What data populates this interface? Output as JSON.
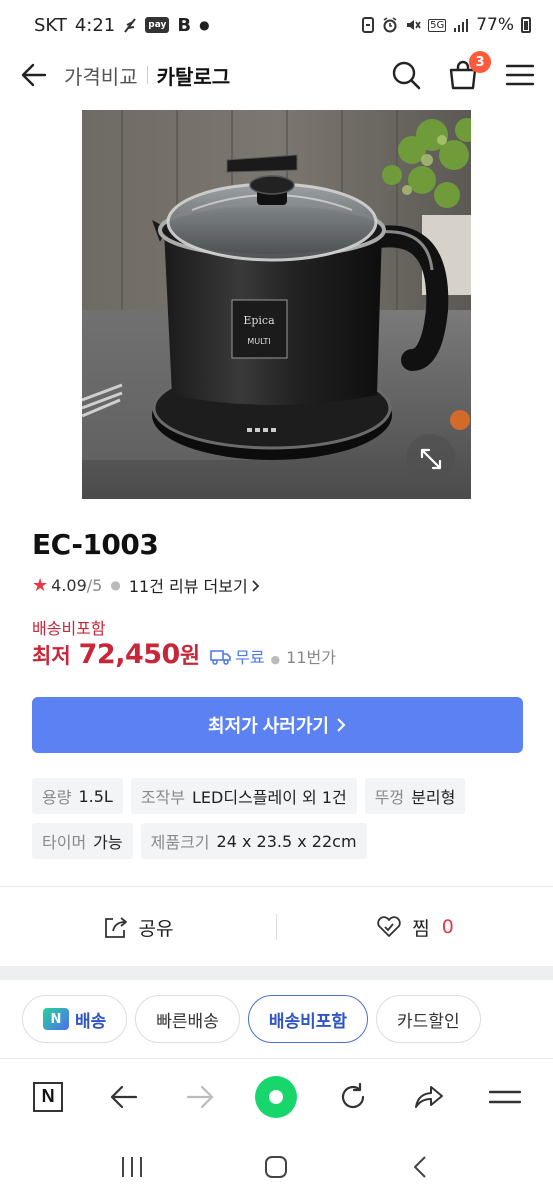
{
  "status_bar": {
    "carrier": "SKT",
    "time": "4:21",
    "pay_label": "pay",
    "b_label": "B",
    "network": "5G",
    "battery": "77%"
  },
  "header": {
    "breadcrumb": "가격비교",
    "title": "카탈로그",
    "cart_count": "3"
  },
  "product": {
    "model": "EC-1003",
    "rating": "4.09",
    "rating_max": "/5",
    "review_link": "11건 리뷰 더보기",
    "shipping_included": "배송비포함",
    "lowest_label": "최저",
    "price": "72,450",
    "currency": "원",
    "shipping_free": "무료",
    "seller": "11번가",
    "buy_button": "최저가 사러가기",
    "specs": [
      [
        {
          "key": "용량",
          "value": "1.5L"
        },
        {
          "key": "조작부",
          "value": "LED디스플레이 외 1건"
        },
        {
          "key": "뚜껑",
          "value": "분리형"
        }
      ],
      [
        {
          "key": "타이머",
          "value": "가능"
        },
        {
          "key": "제품크기",
          "value": "24 x 23.5 x 22cm"
        }
      ]
    ]
  },
  "actions": {
    "share": "공유",
    "wish": "찜",
    "wish_count": "0"
  },
  "filters": {
    "n_badge": "N",
    "delivery": "배송",
    "fast": "빠른배송",
    "free_ship": "배송비포함",
    "card": "카드할인"
  },
  "browser": {
    "n_button": "N"
  },
  "colors": {
    "accent_red": "#c8273a",
    "button_blue": "#5b81f2",
    "active_blue": "#2f56c6",
    "browser_green": "#17d66c"
  }
}
